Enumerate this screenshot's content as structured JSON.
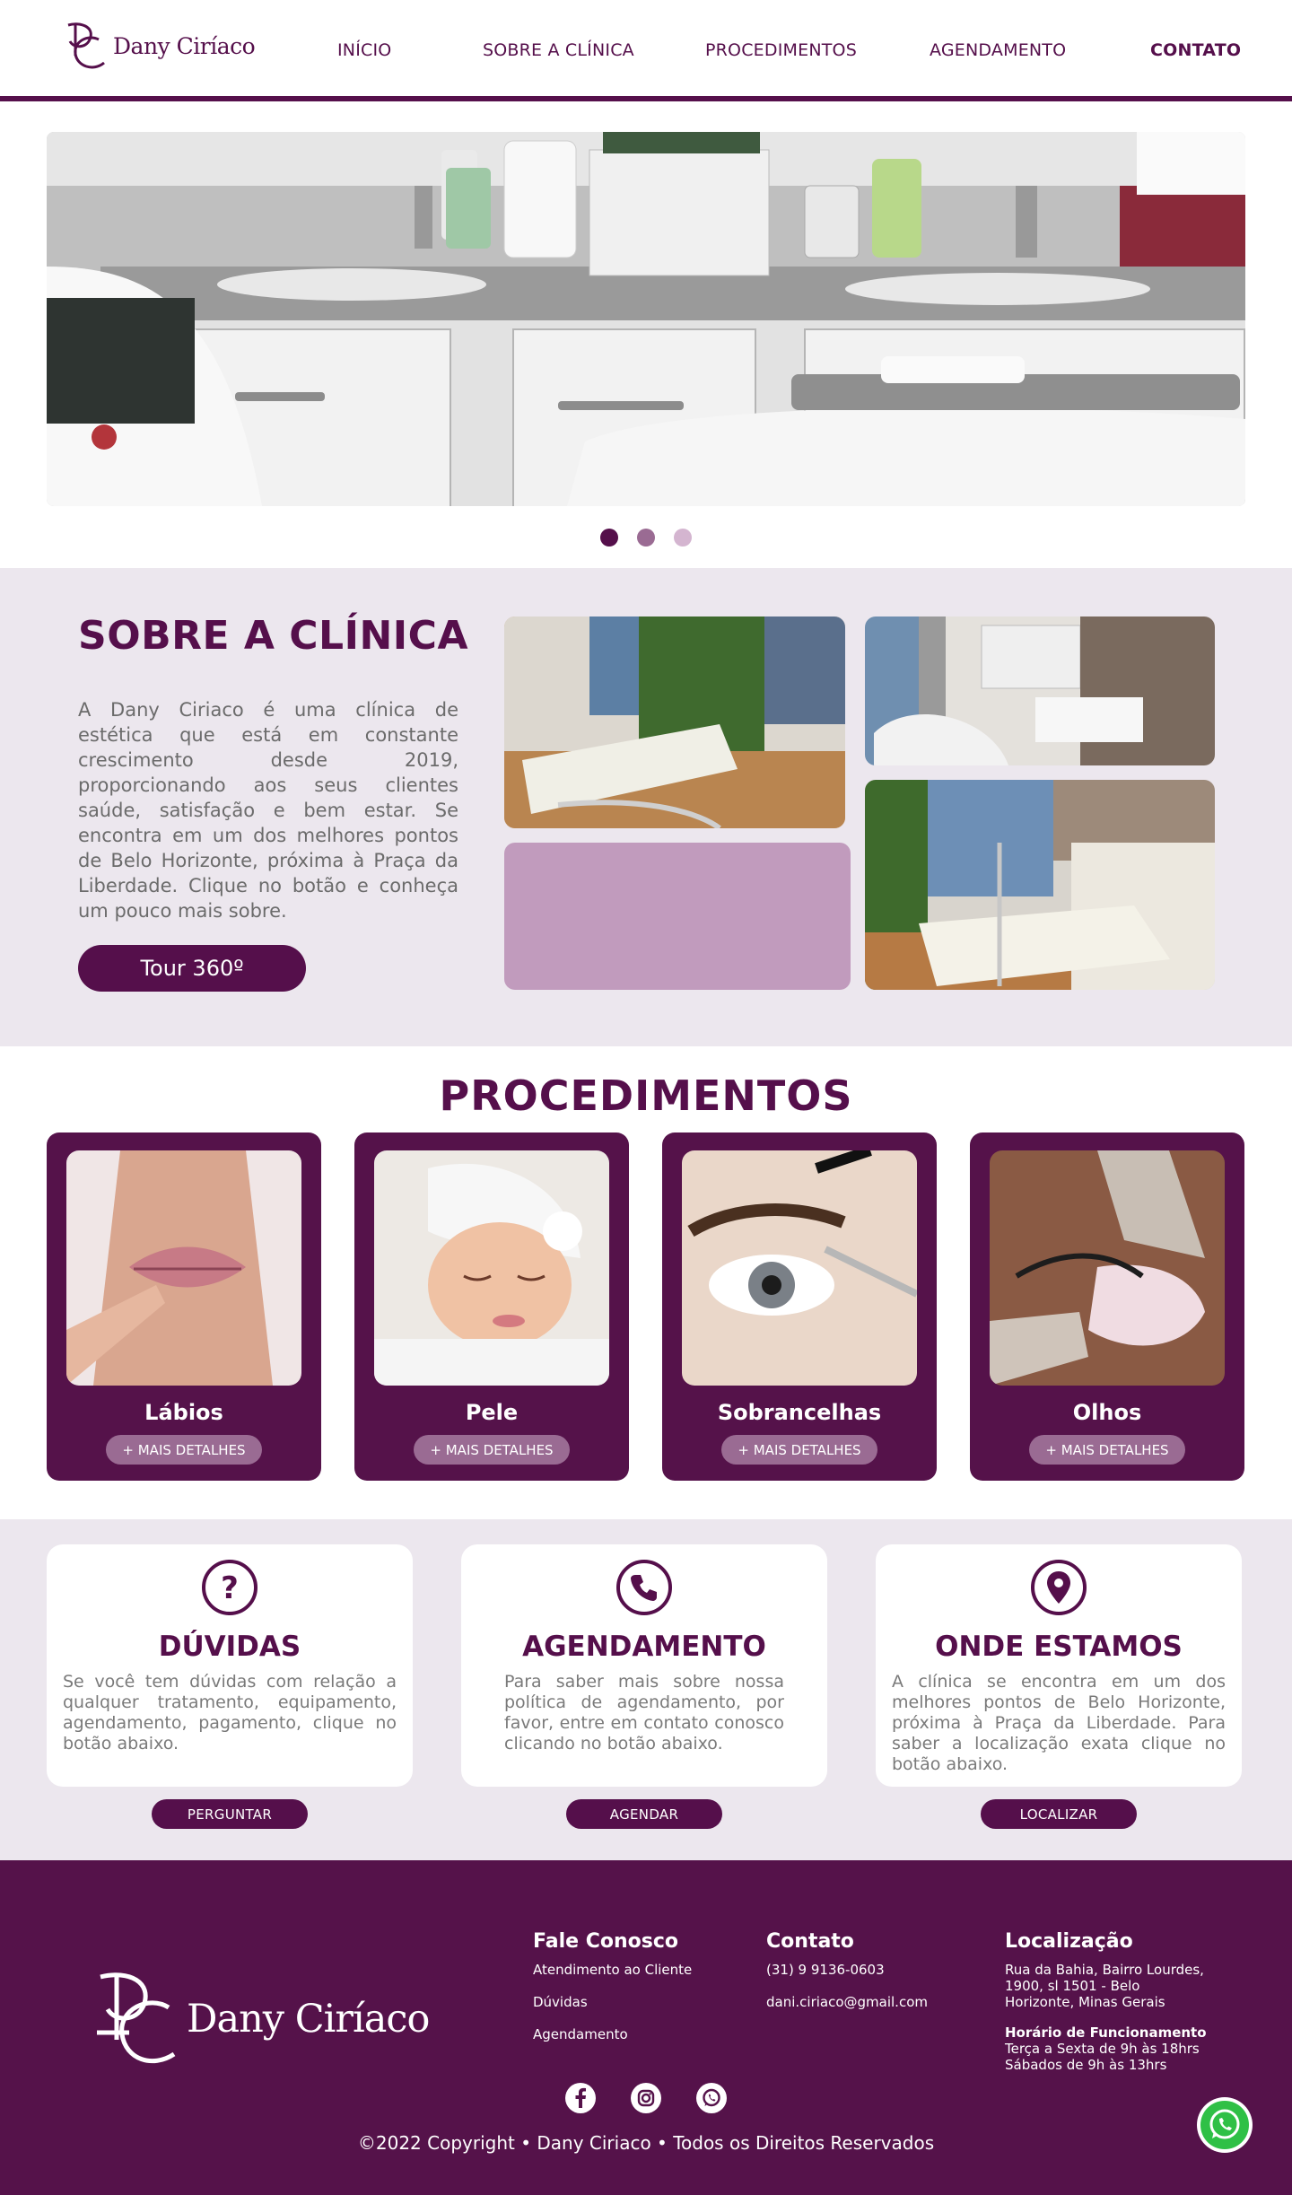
{
  "brand": {
    "name": "Dany Ciríaco",
    "primary": "#550f4b",
    "light": "#c59fc0",
    "bg_section": "#ece7ee"
  },
  "nav": {
    "items": [
      {
        "label": "INÍCIO"
      },
      {
        "label": "SOBRE A CLÍNICA"
      },
      {
        "label": "PROCEDIMENTOS"
      },
      {
        "label": "AGENDAMENTO"
      },
      {
        "label": "CONTATO"
      }
    ],
    "active_index": 4
  },
  "carousel": {
    "slide_count": 3,
    "active_index": 0,
    "dot_colors": [
      "#550f4b",
      "#9a6b93",
      "#d4b5d0"
    ]
  },
  "about": {
    "title": "SOBRE A CLÍNICA",
    "text": "A Dany Ciriaco é uma clínica de estética que está em constante crescimento desde 2019, proporcionando aos seus clientes saúde, satisfação e bem estar. Se encontra em um dos melhores pontos de Belo Horizonte, próxima à Praça da Liberdade. Clique no botão e conheça um pouco mais sobre.",
    "button": "Tour 360º"
  },
  "procedures": {
    "title": "PROCEDIMENTOS",
    "details_label": "+ MAIS DETALHES",
    "items": [
      {
        "name": "Lábios",
        "icon": "lips-photo"
      },
      {
        "name": "Pele",
        "icon": "skin-care-photo"
      },
      {
        "name": "Sobrancelhas",
        "icon": "eyebrow-photo"
      },
      {
        "name": "Olhos",
        "icon": "eyelash-photo"
      }
    ]
  },
  "info": [
    {
      "icon": "question-icon",
      "title": "DÚVIDAS",
      "text": "Se você tem dúvidas com relação a qualquer tratamento, equipamento, agendamento, pagamento, clique no botão abaixo.",
      "button": "PERGUNTAR"
    },
    {
      "icon": "phone-icon",
      "title": "AGENDAMENTO",
      "text": "Para saber mais sobre nossa política de agendamento, por favor, entre em contato conosco clicando no botão abaixo.",
      "button": "AGENDAR"
    },
    {
      "icon": "location-pin-icon",
      "title": "ONDE ESTAMOS",
      "text": "A clínica se encontra em um dos melhores pontos de Belo Horizonte, próxima à Praça da Liberdade. Para saber a localização exata clique no botão abaixo.",
      "button": "LOCALIZAR"
    }
  ],
  "footer": {
    "brand": "Dany Ciríaco",
    "contact_us": {
      "title": "Fale Conosco",
      "links": [
        "Atendimento ao Cliente",
        "Dúvidas",
        "Agendamento"
      ]
    },
    "contact": {
      "title": "Contato",
      "phone": "(31) 9 9136-0603",
      "email": "dani.ciriaco@gmail.com"
    },
    "location": {
      "title": "Localização",
      "address_line1": "Rua da Bahia, Bairro Lourdes,",
      "address_line2": "1900, sl 1501  - Belo",
      "address_line3": "Horizonte, Minas Gerais",
      "hours_title": "Horário de Funcionamento",
      "hours_line1": "Terça a Sexta de 9h às 18hrs",
      "hours_line2": "Sábados de 9h às 13hrs"
    },
    "socials": [
      "facebook-icon",
      "instagram-icon",
      "whatsapp-icon"
    ],
    "copyright": "©2022 Copyright • Dany Ciriaco • Todos os Direitos Reservados"
  }
}
